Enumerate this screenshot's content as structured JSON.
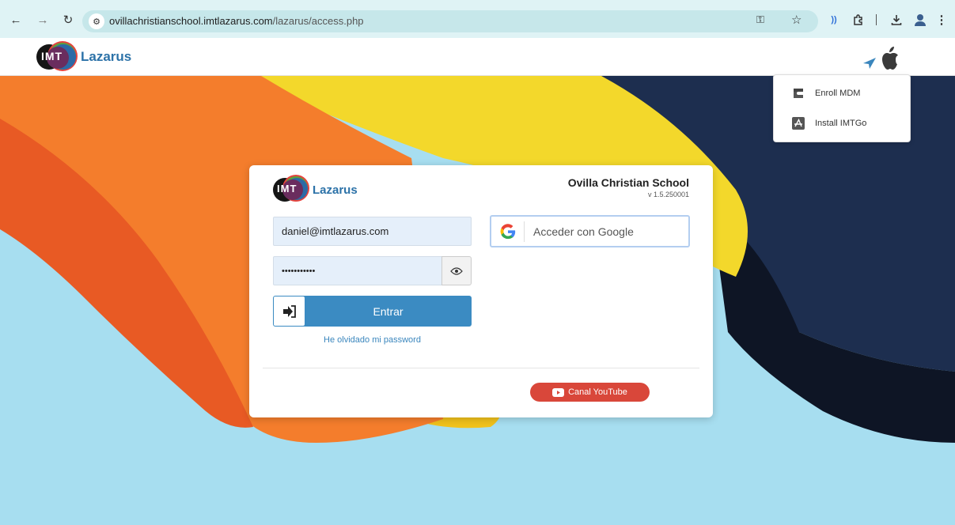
{
  "browser": {
    "url_host": "ovillachristianschool.imtlazarus.com",
    "url_path": "/lazarus/access.php"
  },
  "app": {
    "logo_initials": "IMT",
    "brand": "Lazarus"
  },
  "menu": {
    "items": [
      {
        "label": "Enroll MDM",
        "icon": "magnet-icon"
      },
      {
        "label": "Install IMTGo",
        "icon": "app-store-icon"
      }
    ]
  },
  "login": {
    "school_name": "Ovilla Christian School",
    "version": "v 1.5.250001",
    "email_value": "daniel@imtlazarus.com",
    "password_value": "•••••••••••",
    "enter_label": "Entrar",
    "forgot_label": "He olvidado mi password",
    "google_label": "Acceder con Google",
    "youtube_label": "Canal YouTube"
  },
  "colors": {
    "accent": "#3b8bc2",
    "brand_text": "#2c72a8",
    "youtube": "#d9473a",
    "background_sky": "#a7def0"
  }
}
